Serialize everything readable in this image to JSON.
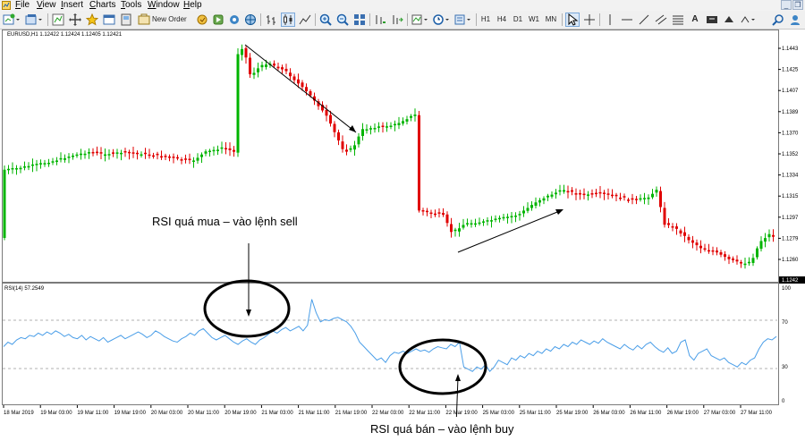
{
  "menu": {
    "items": [
      "File",
      "View",
      "Insert",
      "Charts",
      "Tools",
      "Window",
      "Help"
    ],
    "accel": [
      "F",
      "V",
      "I",
      "C",
      "T",
      "W",
      "H"
    ]
  },
  "toolbar": {
    "new_order_label": "New Order",
    "periods": [
      "H1",
      "H4",
      "D1",
      "W1",
      "MN"
    ],
    "text_tool": "A"
  },
  "chart": {
    "symbol_info": "EURUSD,H1  1.12422 1.12424 1.12405 1.12421",
    "price_ticks": [
      "1.1443",
      "1.1425",
      "1.1407",
      "1.1389",
      "1.1370",
      "1.1352",
      "1.1334",
      "1.1315",
      "1.1297",
      "1.1279",
      "1.1260",
      "1.1242"
    ],
    "current_price": "1.1242",
    "time_ticks": [
      "18 Mar 2019",
      "19 Mar 03:00",
      "19 Mar 11:00",
      "19 Mar 19:00",
      "20 Mar 03:00",
      "20 Mar 11:00",
      "20 Mar 19:00",
      "21 Mar 03:00",
      "21 Mar 11:00",
      "21 Mar 19:00",
      "22 Mar 03:00",
      "22 Mar 11:00",
      "22 Mar 19:00",
      "25 Mar 03:00",
      "25 Mar 11:00",
      "25 Mar 19:00",
      "26 Mar 03:00",
      "26 Mar 11:00",
      "26 Mar 19:00",
      "27 Mar 03:00",
      "27 Mar 11:00"
    ],
    "colors": {
      "bull": "#00b400",
      "bear": "#e00000",
      "rsi": "#4a9ee8",
      "grid_dash": "#b0b0b0"
    }
  },
  "rsi": {
    "label": "RSI(14) 57.2549",
    "levels": [
      "100",
      "70",
      "30",
      "0"
    ],
    "values": [
      48,
      52,
      50,
      54,
      56,
      55,
      58,
      57,
      60,
      58,
      61,
      59,
      62,
      60,
      57,
      59,
      56,
      55,
      58,
      54,
      57,
      55,
      53,
      56,
      52,
      54,
      56,
      58,
      55,
      57,
      59,
      61,
      59,
      56,
      58,
      62,
      60,
      57,
      55,
      53,
      52,
      55,
      57,
      60,
      58,
      62,
      64,
      60,
      56,
      54,
      56,
      58,
      55,
      52,
      50,
      53,
      55,
      52,
      50,
      54,
      56,
      59,
      62,
      60,
      63,
      65,
      62,
      64,
      66,
      62,
      67,
      90,
      78,
      70,
      72,
      71,
      73,
      74,
      72,
      70,
      66,
      60,
      52,
      48,
      44,
      40,
      36,
      38,
      34,
      40,
      43,
      42,
      44,
      42,
      44,
      46,
      44,
      45,
      43,
      46,
      48,
      47,
      46,
      50,
      48,
      52,
      30,
      28,
      26,
      30,
      28,
      32,
      26,
      30,
      36,
      34,
      32,
      38,
      36,
      40,
      38,
      42,
      40,
      44,
      42,
      46,
      44,
      48,
      46,
      50,
      48,
      52,
      50,
      54,
      52,
      50,
      53,
      51,
      55,
      52,
      50,
      48,
      46,
      50,
      47,
      45,
      49,
      46,
      50,
      52,
      48,
      45,
      43,
      47,
      42,
      44,
      52,
      54,
      40,
      36,
      42,
      44,
      46,
      40,
      38,
      36,
      38,
      34,
      32,
      30,
      34,
      32,
      36,
      38,
      46,
      52,
      55,
      54,
      57
    ]
  },
  "annotations": {
    "overbought": "RSI quá mua – vào lệnh sell",
    "oversold": "RSI quá bán – vào lệnh buy"
  }
}
